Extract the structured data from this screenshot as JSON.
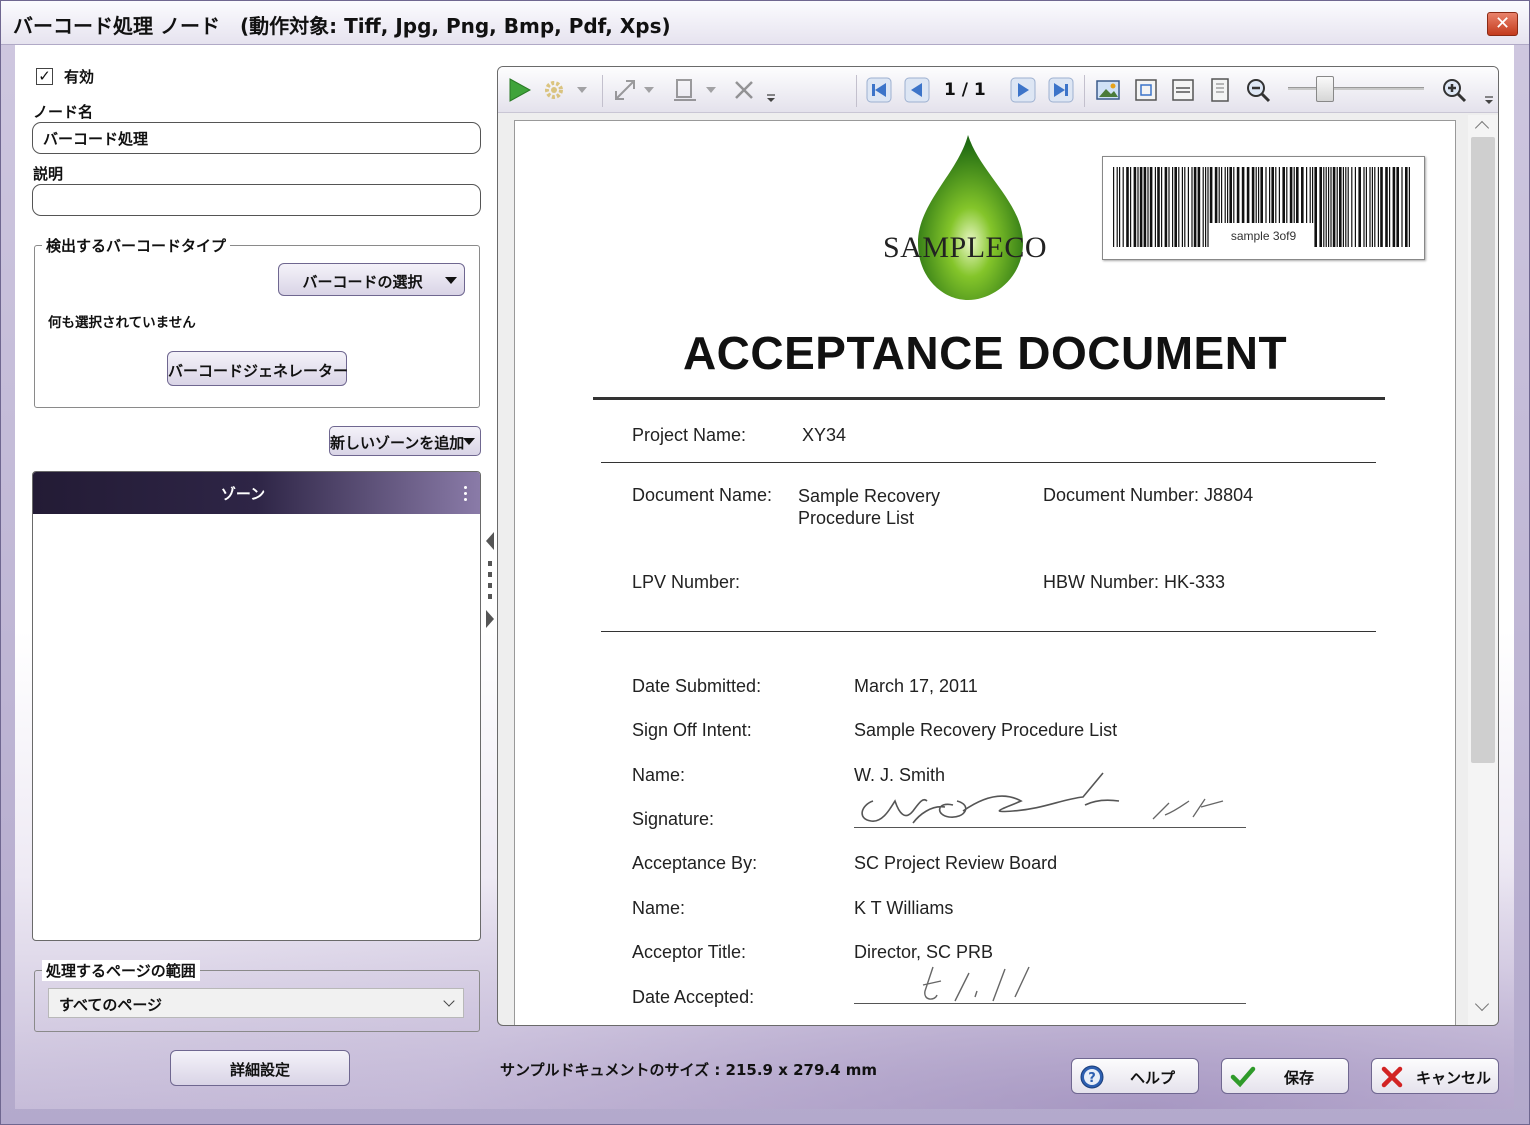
{
  "window": {
    "title": "バーコード処理 ノード　(動作対象: Tiff, Jpg, Png, Bmp, Pdf, Xps)",
    "close_glyph": "✕"
  },
  "left": {
    "enabled_checked": true,
    "enabled_label": "有効",
    "node_name_label": "ノード名",
    "node_name_value": "バーコード処理",
    "description_label": "説明",
    "description_value": "",
    "barcode_group": {
      "title": "検出するバーコードタイプ",
      "select_button": "バーコードの選択",
      "none_selected": "何も選択されていません",
      "generator_button": "バーコードジェネレーター"
    },
    "add_zone_button": "新しいゾーンを追加",
    "zone_header": "ゾーン",
    "page_range": {
      "title": "処理するページの範囲",
      "selected": "すべてのページ"
    },
    "advanced_button": "詳細設定"
  },
  "viewer": {
    "page_current": "1",
    "page_sep": "/",
    "page_total": "1",
    "document": {
      "company": "SAMPLECO",
      "barcode_text": "sample 3of9",
      "title": "ACCEPTANCE DOCUMENT",
      "project_name_label": "Project Name:",
      "project_name": "XY34",
      "document_name_label": "Document Name:",
      "document_name": "Sample Recovery Procedure List",
      "document_number": "Document Number: J8804",
      "lpv_label": "LPV Number:",
      "hbw": "HBW Number: HK-333",
      "date_submitted_label": "Date Submitted:",
      "date_submitted": "March 17, 2011",
      "sign_off_label": "Sign Off Intent:",
      "sign_off": "Sample Recovery Procedure List",
      "name1_label": "Name:",
      "name1": "W. J. Smith",
      "signature_label": "Signature:",
      "acceptance_by_label": "Acceptance By:",
      "acceptance_by": "SC Project Review Board",
      "name2_label": "Name:",
      "name2": "K T Williams",
      "acceptor_title_label": "Acceptor Title:",
      "acceptor_title": "Director, SC PRB",
      "date_accepted_label": "Date Accepted:"
    }
  },
  "footer": {
    "sample_size": "サンプルドキュメントのサイズ : 215.9 x 279.4 mm",
    "help_button": "ヘルプ",
    "save_button": "保存",
    "cancel_button": "キャンセル"
  },
  "colors": {
    "accent": "#6f6790",
    "zone_header": "#231b35",
    "play_green": "#3fa33a",
    "nav_blue": "#3c74c9",
    "cancel_red": "#d22323"
  }
}
